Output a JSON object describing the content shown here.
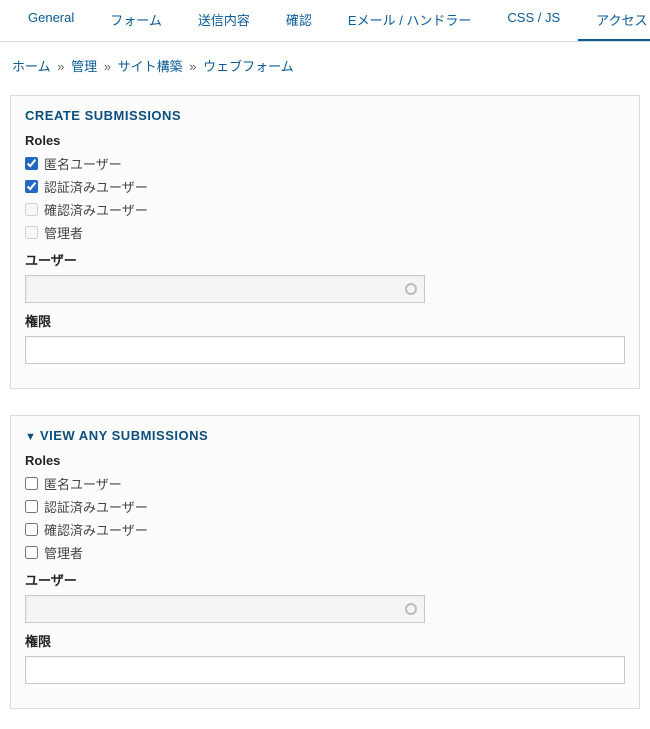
{
  "tabs": [
    {
      "label": "General",
      "active": false
    },
    {
      "label": "フォーム",
      "active": false
    },
    {
      "label": "送信内容",
      "active": false
    },
    {
      "label": "確認",
      "active": false
    },
    {
      "label": "Eメール / ハンドラー",
      "active": false
    },
    {
      "label": "CSS / JS",
      "active": false
    },
    {
      "label": "アクセス",
      "active": true
    }
  ],
  "breadcrumb": {
    "items": [
      "ホーム",
      "管理",
      "サイト構築",
      "ウェブフォーム"
    ],
    "sep": "»"
  },
  "panelCreate": {
    "title": "CREATE SUBMISSIONS",
    "rolesLabel": "Roles",
    "roles": [
      {
        "label": "匿名ユーザー",
        "checked": true,
        "disabled": false
      },
      {
        "label": "認証済みユーザー",
        "checked": true,
        "disabled": false
      },
      {
        "label": "確認済みユーザー",
        "checked": false,
        "disabled": true
      },
      {
        "label": "管理者",
        "checked": false,
        "disabled": true
      }
    ],
    "userLabel": "ユーザー",
    "userValue": "",
    "permLabel": "権限",
    "permValue": ""
  },
  "panelView": {
    "title": "VIEW ANY SUBMISSIONS",
    "rolesLabel": "Roles",
    "roles": [
      {
        "label": "匿名ユーザー",
        "checked": false,
        "disabled": false
      },
      {
        "label": "認証済みユーザー",
        "checked": false,
        "disabled": false
      },
      {
        "label": "確認済みユーザー",
        "checked": false,
        "disabled": false
      },
      {
        "label": "管理者",
        "checked": false,
        "disabled": false
      }
    ],
    "userLabel": "ユーザー",
    "userValue": "",
    "permLabel": "権限",
    "permValue": ""
  }
}
